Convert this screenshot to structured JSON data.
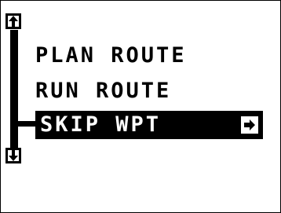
{
  "menu": {
    "items": [
      {
        "label": "PLAN ROUTE",
        "selected": false
      },
      {
        "label": "RUN ROUTE",
        "selected": false
      },
      {
        "label": "SKIP WPT",
        "selected": true,
        "has_submenu": true
      }
    ]
  },
  "scrollbar": {
    "up_icon": "arrow-up-icon",
    "down_icon": "arrow-down-icon"
  },
  "submenu_icon": "arrow-right-icon",
  "colors": {
    "foreground": "#000000",
    "background": "#ffffff",
    "highlight_bg": "#000000",
    "highlight_fg": "#ffffff"
  }
}
